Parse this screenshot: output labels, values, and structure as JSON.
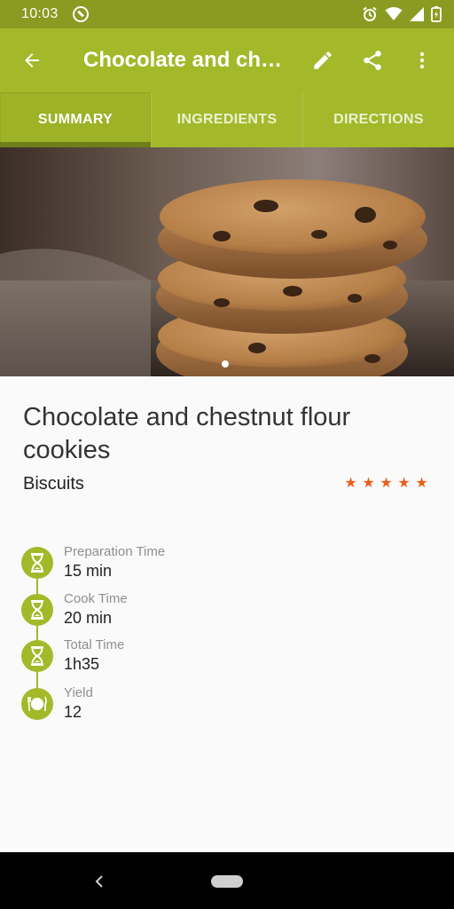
{
  "status_bar": {
    "time": "10:03",
    "icons": [
      "sync-icon",
      "alarm-icon",
      "wifi-icon",
      "signal-icon",
      "battery-icon"
    ]
  },
  "app_bar": {
    "title": "Chocolate and chestnut flour cookies",
    "actions": [
      "back-arrow-icon",
      "edit-icon",
      "share-icon",
      "more-vert-icon"
    ]
  },
  "tabs": [
    {
      "label": "SUMMARY",
      "active": true
    },
    {
      "label": "INGREDIENTS",
      "active": false
    },
    {
      "label": "DIRECTIONS",
      "active": false
    }
  ],
  "recipe": {
    "title": "Chocolate and chestnut flour cookies",
    "category": "Biscuits",
    "rating": 5,
    "stars": [
      "★",
      "★",
      "★",
      "★",
      "★"
    ]
  },
  "details": [
    {
      "label": "Preparation Time",
      "value": "15 min",
      "icon": "hourglass-icon"
    },
    {
      "label": "Cook Time",
      "value": "20 min",
      "icon": "hourglass-icon"
    },
    {
      "label": "Total Time",
      "value": "1h35",
      "icon": "hourglass-icon"
    },
    {
      "label": "Yield",
      "value": "12",
      "icon": "plate-icon"
    }
  ],
  "colors": {
    "primary": "#a3b92a",
    "status_bar": "#8a9b22",
    "tab_indicator": "#6e7e1a",
    "star": "#e8601c"
  }
}
